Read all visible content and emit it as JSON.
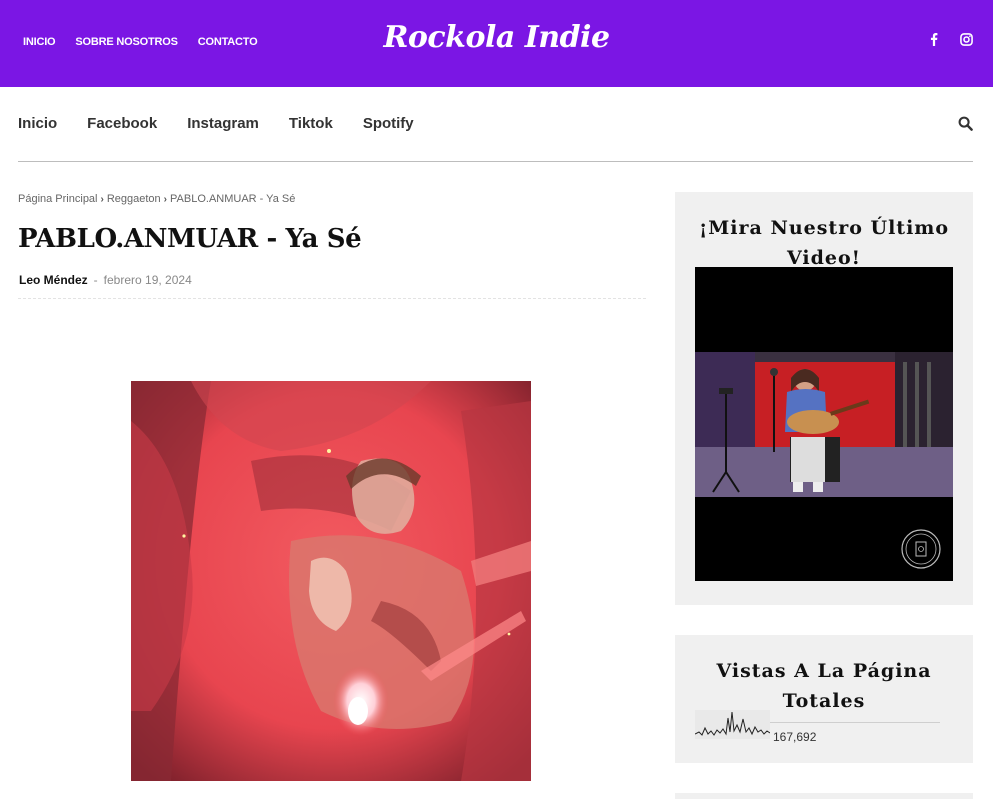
{
  "header": {
    "top_nav": [
      "INICIO",
      "SOBRE NOSOTROS",
      "CONTACTO"
    ],
    "logo": "Rockola Indie",
    "bg_color": "#7b16e4",
    "social_icons": [
      "facebook-icon",
      "instagram-icon"
    ]
  },
  "main_nav": {
    "items": [
      "Inicio",
      "Facebook",
      "Instagram",
      "Tiktok",
      "Spotify"
    ],
    "search_icon": "search-icon"
  },
  "breadcrumb": {
    "items": [
      "Página Principal",
      "Reggaeton",
      "PABLO.ANMUAR - Ya Sé"
    ]
  },
  "post": {
    "title": "PABLO.ANMUAR - Ya Sé",
    "author": "Leo Méndez",
    "separator": "-",
    "date": "febrero 19, 2024"
  },
  "sidebar": {
    "video_widget": {
      "title": "¡Mira Nuestro Último Video!"
    },
    "stats_widget": {
      "title": "Vistas A La Página Totales",
      "count": "167,692"
    }
  }
}
